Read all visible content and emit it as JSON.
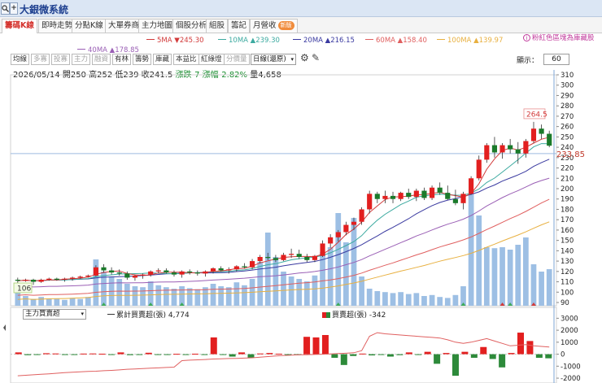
{
  "app": {
    "title": "大銀微系統",
    "search_icon": "magnifier-icon",
    "add_label": "+"
  },
  "tabs": [
    {
      "label": "籌碼K線",
      "active": true
    },
    {
      "label": "即時走勢"
    },
    {
      "label": "分點K線"
    },
    {
      "label": "大單券商"
    },
    {
      "label": "主力地圖"
    },
    {
      "label": "個股分析"
    },
    {
      "label": "組股"
    },
    {
      "label": "籌記"
    },
    {
      "label": "月營收",
      "badge": "新版"
    }
  ],
  "ma_legend": [
    {
      "name": "5MA",
      "arrow": "▼",
      "value": "245.30",
      "color": "#d23a3a"
    },
    {
      "name": "10MA",
      "arrow": "▲",
      "value": "239.30",
      "color": "#3caaa0"
    },
    {
      "name": "20MA",
      "arrow": "▲",
      "value": "216.15",
      "color": "#3a3aa0"
    },
    {
      "name": "60MA",
      "arrow": "▲",
      "value": "158.40",
      "color": "#e05f5f"
    },
    {
      "name": "100MA",
      "arrow": "▲",
      "value": "139.97",
      "color": "#e8b040"
    },
    {
      "name": "40MA",
      "arrow": "▲",
      "value": "178.85",
      "color": "#9a5fb5"
    }
  ],
  "hint": "粉紅色區塊為庫藏股",
  "toolbar": {
    "buttons": [
      {
        "label": "均線",
        "dim": false
      },
      {
        "label": "多寡",
        "dim": true
      },
      {
        "label": "投寡",
        "dim": true
      },
      {
        "label": "主力",
        "dim": true
      },
      {
        "label": "融資",
        "dim": true
      },
      {
        "label": "有林",
        "dim": false
      },
      {
        "label": "籌勢",
        "dim": false
      },
      {
        "label": "庫藏",
        "dim": false
      },
      {
        "label": "本益比",
        "dim": false
      },
      {
        "label": "紅綠燈",
        "dim": false
      },
      {
        "label": "分價量",
        "dim": true
      }
    ],
    "period_select": "日線(還原)",
    "display_label": "顯示：",
    "display_count": "60"
  },
  "price_info": {
    "date": "2026/05/14",
    "open_label": "開",
    "open": "250",
    "high_label": "高",
    "high": "252",
    "low_label": "低",
    "low": "239",
    "close_label": "收",
    "close": "241.5",
    "change_label": "漲跌",
    "change": "-7",
    "pct_label": "漲幅",
    "pct": "-2.82%",
    "vol_label": "量",
    "volume": "4,658"
  },
  "price_axis": {
    "ticks": [
      "310",
      "300",
      "290",
      "280",
      "270",
      "260",
      "250",
      "240",
      "230",
      "220",
      "210",
      "200",
      "190",
      "180",
      "170",
      "160",
      "150",
      "140",
      "130",
      "120",
      "110",
      "100",
      "90"
    ],
    "current_label": "233.85",
    "high_marker": "264.5",
    "low_marker": "106"
  },
  "lower_panel": {
    "select": "主力買賣超",
    "legend_cum": "累計買賣超(張)",
    "legend_cum_value": "4,774",
    "legend_daily": "買賣超(張)",
    "legend_daily_value": "-342",
    "ticks": [
      "3000",
      "2000",
      "1000",
      "0",
      "-1000",
      "-2000"
    ]
  },
  "chart_data": {
    "type": "candlestick",
    "candles": [
      [
        112,
        114,
        109,
        111
      ],
      [
        111,
        113,
        110,
        112
      ],
      [
        112,
        113,
        107,
        110
      ],
      [
        110,
        113,
        109,
        112
      ],
      [
        112,
        114,
        111,
        113
      ],
      [
        113,
        114,
        111,
        112
      ],
      [
        112,
        114,
        110,
        113
      ],
      [
        113,
        115,
        111,
        114
      ],
      [
        114,
        116,
        113,
        115
      ],
      [
        115,
        117,
        114,
        116
      ],
      [
        116,
        126,
        115,
        124
      ],
      [
        124,
        127,
        119,
        121
      ],
      [
        121,
        124,
        117,
        119
      ],
      [
        119,
        122,
        116,
        118
      ],
      [
        118,
        120,
        112,
        114
      ],
      [
        114,
        117,
        111,
        116
      ],
      [
        116,
        118,
        113,
        117
      ],
      [
        117,
        121,
        115,
        120
      ],
      [
        120,
        123,
        118,
        121
      ],
      [
        121,
        123,
        118,
        119
      ],
      [
        119,
        121,
        115,
        117
      ],
      [
        117,
        121,
        114,
        120
      ],
      [
        120,
        122,
        117,
        119
      ],
      [
        119,
        121,
        116,
        118
      ],
      [
        118,
        121,
        115,
        120
      ],
      [
        120,
        124,
        118,
        123
      ],
      [
        123,
        125,
        120,
        121
      ],
      [
        121,
        124,
        118,
        122
      ],
      [
        122,
        126,
        120,
        125
      ],
      [
        125,
        128,
        123,
        124
      ],
      [
        124,
        132,
        122,
        130
      ],
      [
        130,
        136,
        128,
        134
      ],
      [
        134,
        138,
        131,
        133
      ],
      [
        133,
        136,
        129,
        131
      ],
      [
        131,
        138,
        130,
        136
      ],
      [
        136,
        142,
        133,
        137
      ],
      [
        137,
        141,
        132,
        134
      ],
      [
        134,
        137,
        129,
        131
      ],
      [
        131,
        136,
        129,
        135
      ],
      [
        135,
        150,
        134,
        147
      ],
      [
        147,
        156,
        143,
        153
      ],
      [
        153,
        160,
        149,
        158
      ],
      [
        158,
        168,
        155,
        165
      ],
      [
        165,
        172,
        160,
        168
      ],
      [
        168,
        182,
        165,
        180
      ],
      [
        180,
        198,
        176,
        195
      ],
      [
        195,
        197,
        186,
        190
      ],
      [
        190,
        198,
        186,
        193
      ],
      [
        193,
        197,
        186,
        190
      ],
      [
        190,
        197,
        188,
        196
      ],
      [
        196,
        200,
        190,
        192
      ],
      [
        192,
        200,
        188,
        198
      ],
      [
        198,
        201,
        189,
        191
      ],
      [
        191,
        203,
        189,
        201
      ],
      [
        201,
        206,
        194,
        196
      ],
      [
        196,
        203,
        189,
        190
      ],
      [
        190,
        199,
        184,
        186
      ],
      [
        186,
        197,
        180,
        195
      ],
      [
        195,
        212,
        194,
        210
      ],
      [
        210,
        232,
        208,
        228
      ],
      [
        228,
        244,
        225,
        242
      ],
      [
        242,
        250,
        230,
        235
      ],
      [
        235,
        244,
        229,
        242
      ],
      [
        242,
        248,
        234,
        238
      ],
      [
        238,
        245,
        224,
        234
      ],
      [
        234,
        248,
        230,
        246
      ],
      [
        246,
        264.5,
        244,
        258
      ],
      [
        258,
        262,
        248,
        253
      ],
      [
        253,
        256,
        240,
        241.5
      ]
    ],
    "volume": [
      30,
      20,
      14,
      18,
      15,
      14,
      12,
      16,
      14,
      18,
      95,
      70,
      60,
      55,
      45,
      40,
      38,
      50,
      42,
      38,
      35,
      40,
      36,
      34,
      38,
      45,
      40,
      38,
      48,
      42,
      55,
      90,
      150,
      100,
      70,
      60,
      55,
      50,
      62,
      110,
      120,
      190,
      130,
      180,
      60,
      35,
      30,
      28,
      26,
      28,
      24,
      26,
      20,
      22,
      18,
      16,
      22,
      40,
      230,
      185,
      120,
      118,
      120,
      115,
      125,
      140,
      85,
      70,
      75
    ],
    "ma5": [],
    "ma_note": "",
    "flow": [
      150,
      -80,
      -40,
      80,
      60,
      -50,
      -40,
      50,
      60,
      40,
      -60,
      150,
      -80,
      -50,
      120,
      -40,
      -50,
      30,
      -20,
      40,
      -30,
      1400,
      -50,
      -200,
      150,
      -300,
      60,
      100,
      40,
      -60,
      -80,
      1450,
      1400,
      1600,
      -300,
      -900,
      -150,
      50,
      -100,
      -60,
      -200,
      -80,
      150,
      -50,
      200,
      -800,
      100,
      -1800,
      200,
      -300,
      600,
      -400,
      -1100,
      100,
      1800,
      1100,
      -300,
      -342
    ],
    "flow_cum": [
      -1800,
      -1760,
      -1720,
      -1680,
      -1640,
      -1590,
      -1540,
      -1500,
      -1470,
      -1440,
      -1420,
      -1380,
      -1350,
      -1310,
      -1260,
      -1230,
      -1200,
      -1170,
      -1140,
      -1110,
      -1080,
      -540,
      -500,
      -470,
      -440,
      -400,
      -380,
      -360,
      -350,
      -330,
      -300,
      -250,
      -200,
      -150,
      -100,
      -80,
      -50,
      -40,
      -20,
      0,
      20,
      50,
      80,
      120,
      300,
      1500,
      1800,
      1700,
      1650,
      1600,
      1550,
      1500,
      1450,
      1400,
      1350,
      1200,
      1000,
      900,
      1000,
      1150,
      1300,
      1100,
      900,
      700,
      750,
      800,
      700,
      650,
      600
    ]
  }
}
